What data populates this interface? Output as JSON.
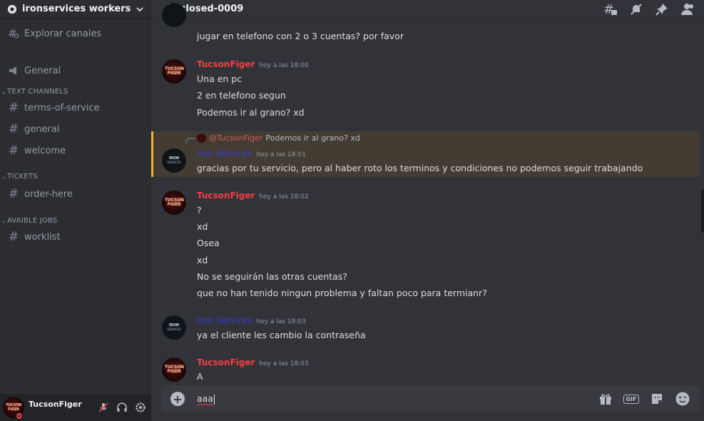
{
  "server": {
    "name": "ironservices workers"
  },
  "nav": {
    "explore": "Explorar canales",
    "general": "General"
  },
  "categories": [
    {
      "name": "TEXT CHANNELS",
      "channels": [
        "terms-of-service",
        "general",
        "welcome"
      ]
    },
    {
      "name": "TICKETS",
      "channels": [
        "order-here"
      ]
    },
    {
      "name": "AVAIBLE JOBS",
      "channels": [
        "worklist"
      ]
    }
  ],
  "user": {
    "name": "TucsonFiger"
  },
  "channel": {
    "title": "closed-0009"
  },
  "avatar_text": {
    "tucson": "TUCSON FIGER",
    "iron_1": "IRON",
    "iron_2": "SERVICES"
  },
  "messages": {
    "m0": {
      "line1": "jugar en telefono con  2 o 3 cuentas? por favor"
    },
    "m1": {
      "author": "TucsonFiger",
      "time": "hoy a las 18:00",
      "lines": [
        "Una en pc",
        "2 en telefono segun",
        "Podemos ir al grano? xd"
      ]
    },
    "m2": {
      "reply_mention": "@TucsonFiger",
      "reply_text": "Podemos ir al grano? xd",
      "author": "Iron Services",
      "time": "hoy a las 18:01",
      "lines": [
        "gracias por tu servicio, pero al haber roto los terminos y condiciones no podemos seguir trabajando"
      ]
    },
    "m3": {
      "author": "TucsonFiger",
      "time": "hoy a las 18:02",
      "lines": [
        "?",
        "xd",
        "Osea",
        "xd",
        "No se seguirán las otras cuentas?",
        "que no han tenido ningun problema y faltan poco para termianr?"
      ]
    },
    "m4": {
      "author": "Iron Services",
      "time": "hoy a las 18:03",
      "lines": [
        "ya el cliente les cambio la contraseña"
      ]
    },
    "m5": {
      "author": "TucsonFiger",
      "time": "hoy a las 18:03",
      "lines": [
        "A"
      ]
    }
  },
  "composer": {
    "value": "aaa",
    "gif_label": "GIF"
  },
  "colors": {
    "author_red": "#f23f43",
    "author_blue": "#3b3bd6",
    "highlight": "#433c32",
    "highlight_bar": "#f0b232"
  },
  "icons": {
    "server": "gear-icon",
    "header_chevron": "chevron-down-icon",
    "explore": "hashtag-search-icon",
    "general": "megaphone-icon",
    "topbar": [
      "threads-icon",
      "mute-bell-icon",
      "pin-icon",
      "members-icon"
    ],
    "user_controls": [
      "muted-mic-icon",
      "headphones-icon",
      "settings-icon"
    ],
    "composer": [
      "gift-icon",
      "gif-icon",
      "sticker-icon",
      "emoji-icon"
    ]
  }
}
